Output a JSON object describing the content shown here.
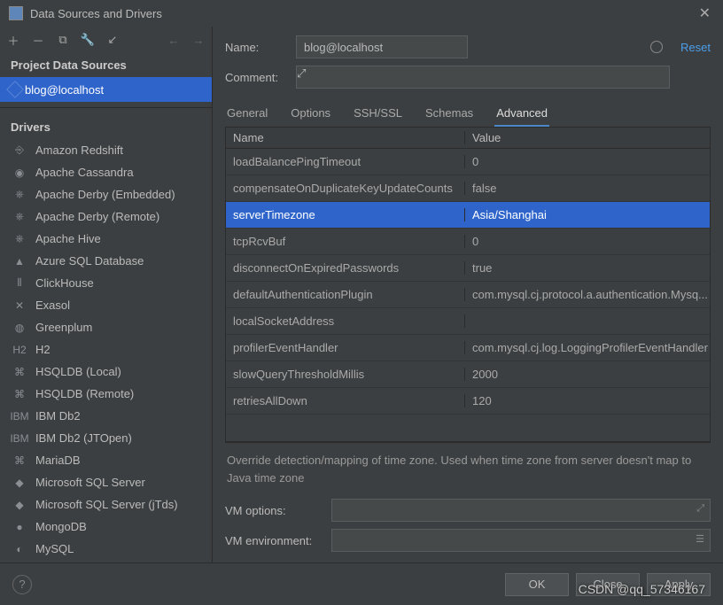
{
  "window": {
    "title": "Data Sources and Drivers"
  },
  "sidebar": {
    "project_header": "Project Data Sources",
    "data_source": "blog@localhost",
    "drivers_header": "Drivers",
    "drivers": [
      "Amazon Redshift",
      "Apache Cassandra",
      "Apache Derby (Embedded)",
      "Apache Derby (Remote)",
      "Apache Hive",
      "Azure SQL Database",
      "ClickHouse",
      "Exasol",
      "Greenplum",
      "H2",
      "HSQLDB (Local)",
      "HSQLDB (Remote)",
      "IBM Db2",
      "IBM Db2 (JTOpen)",
      "MariaDB",
      "Microsoft SQL Server",
      "Microsoft SQL Server (jTds)",
      "MongoDB",
      "MySQL"
    ]
  },
  "form": {
    "name_label": "Name:",
    "name_value": "blog@localhost",
    "comment_label": "Comment:",
    "reset": "Reset"
  },
  "tabs": [
    "General",
    "Options",
    "SSH/SSL",
    "Schemas",
    "Advanced"
  ],
  "active_tab": "Advanced",
  "grid": {
    "headers": {
      "name": "Name",
      "value": "Value"
    },
    "rows": [
      {
        "name": "loadBalancePingTimeout",
        "value": "0"
      },
      {
        "name": "compensateOnDuplicateKeyUpdateCounts",
        "value": "false"
      },
      {
        "name": "serverTimezone",
        "value": "Asia/Shanghai",
        "selected": true
      },
      {
        "name": "tcpRcvBuf",
        "value": "0"
      },
      {
        "name": "disconnectOnExpiredPasswords",
        "value": "true"
      },
      {
        "name": "defaultAuthenticationPlugin",
        "value": "com.mysql.cj.protocol.a.authentication.Mysq..."
      },
      {
        "name": "localSocketAddress",
        "value": ""
      },
      {
        "name": "profilerEventHandler",
        "value": "com.mysql.cj.log.LoggingProfilerEventHandler"
      },
      {
        "name": "slowQueryThresholdMillis",
        "value": "2000"
      },
      {
        "name": "retriesAllDown",
        "value": "120"
      }
    ]
  },
  "hint": "Override detection/mapping of time zone. Used when time zone from server doesn't map to Java time zone",
  "vm": {
    "options_label": "VM options:",
    "env_label": "VM environment:"
  },
  "footer": {
    "ok": "OK",
    "cancel": "Close",
    "apply": "Apply"
  },
  "watermark": "CSDN @qq_57346167"
}
